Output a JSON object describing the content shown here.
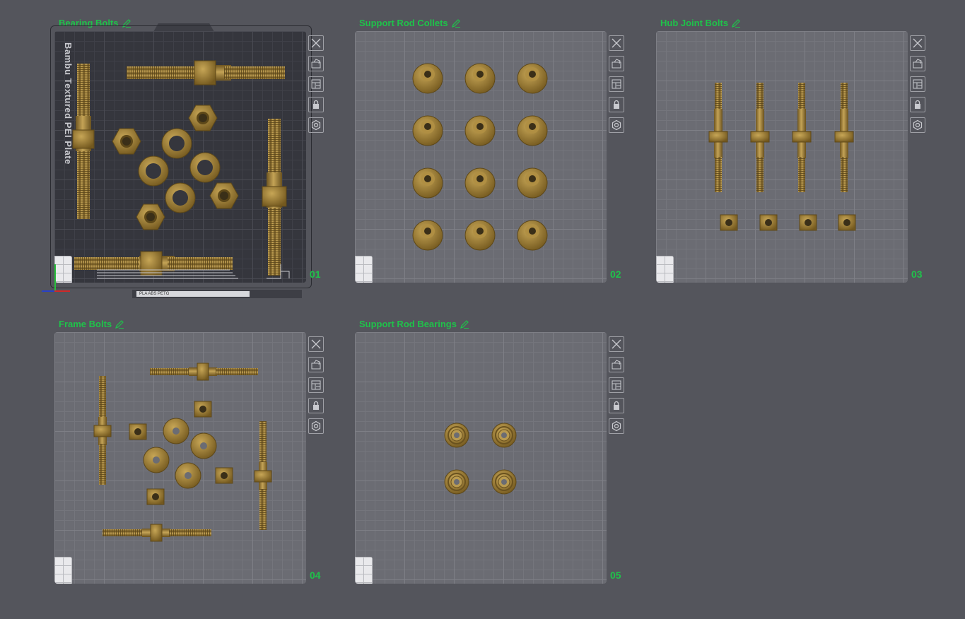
{
  "plates": [
    {
      "id": "p1",
      "title": "Bearing Bolts",
      "number": "01",
      "bed_label": "Bambu Textured PEI Plate",
      "filament_label": "PLA ABS PETG"
    },
    {
      "id": "p2",
      "title": "Support Rod Collets",
      "number": "02"
    },
    {
      "id": "p3",
      "title": "Hub Joint Bolts",
      "number": "03"
    },
    {
      "id": "p4",
      "title": "Frame Bolts",
      "number": "04"
    },
    {
      "id": "p5",
      "title": "Support Rod Bearings",
      "number": "05"
    }
  ],
  "tools": [
    {
      "name": "delete-plate-button",
      "icon": "close-icon"
    },
    {
      "name": "auto-orient-button",
      "icon": "orient-icon"
    },
    {
      "name": "arrange-button",
      "icon": "arrange-icon"
    },
    {
      "name": "lock-plate-button",
      "icon": "lock-icon"
    },
    {
      "name": "plate-settings-button",
      "icon": "gear-icon"
    }
  ],
  "colors": {
    "accent": "#1fc24a",
    "part": "#9a7c35",
    "background": "#54555c"
  }
}
